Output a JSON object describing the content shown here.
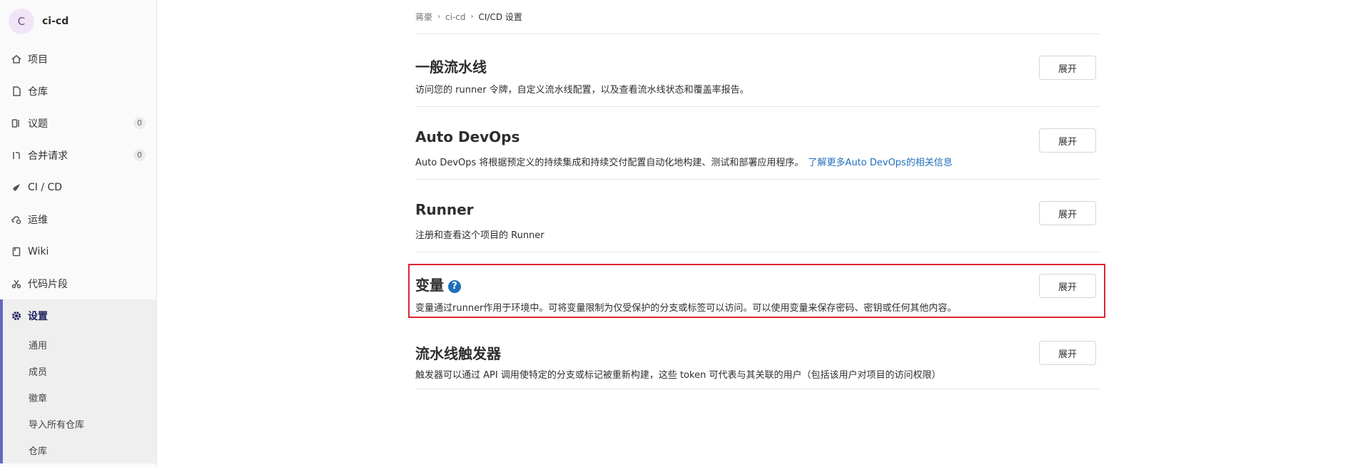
{
  "sidebar": {
    "avatar_letter": "C",
    "project_name": "ci-cd",
    "items": [
      {
        "label": "项目",
        "icon": "home-icon"
      },
      {
        "label": "仓库",
        "icon": "document-icon"
      },
      {
        "label": "议题",
        "icon": "issues-icon",
        "count": "0"
      },
      {
        "label": "合并请求",
        "icon": "merge-request-icon",
        "count": "0"
      },
      {
        "label": "CI / CD",
        "icon": "rocket-icon"
      },
      {
        "label": "运维",
        "icon": "cloud-gear-icon"
      },
      {
        "label": "Wiki",
        "icon": "book-icon"
      },
      {
        "label": "代码片段",
        "icon": "scissors-icon"
      },
      {
        "label": "设置",
        "icon": "gear-icon"
      }
    ],
    "sub_items": [
      "通用",
      "成员",
      "徽章",
      "导入所有仓库",
      "仓库"
    ]
  },
  "breadcrumb": [
    "蒋豪",
    "ci-cd",
    "CI/CD 设置"
  ],
  "sections": [
    {
      "title": "一般流水线",
      "description": "访问您的 runner 令牌，自定义流水线配置，以及查看流水线状态和覆盖率报告。",
      "button": "展开"
    },
    {
      "title": "Auto DevOps",
      "description": "Auto DevOps 将根据预定义的持续集成和持续交付配置自动化地构建、测试和部署应用程序。",
      "link": "了解更多Auto DevOps的相关信息",
      "button": "展开"
    },
    {
      "title": "Runner",
      "description": "注册和查看这个项目的 Runner",
      "button": "展开"
    },
    {
      "title": "变量",
      "help": "?",
      "description": "变量通过runner作用于环境中。可将变量限制为仅受保护的分支或标签可以访问。可以使用变量来保存密码、密钥或任何其他内容。",
      "button": "展开"
    },
    {
      "title": "流水线触发器",
      "description": "触发器可以通过 API 调用使特定的分支或标记被重新构建，这些 token 可代表与其关联的用户（包括该用户对项目的访问权限）",
      "button": "展开"
    }
  ],
  "colors": {
    "accent": "#6666c4",
    "link": "#1f6fbd",
    "highlight": "#e0262f"
  }
}
